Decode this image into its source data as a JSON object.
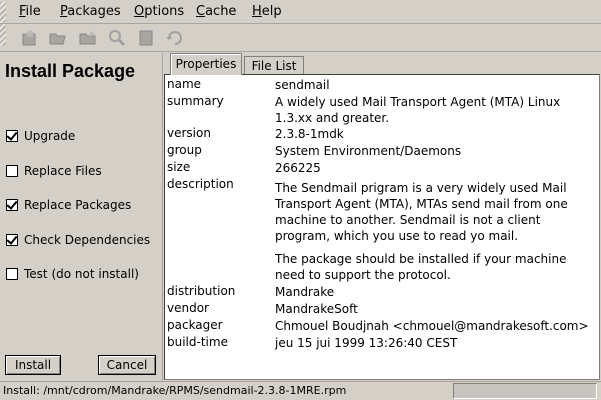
{
  "menubar": {
    "items": [
      {
        "label_mn": "F",
        "label_rest": "ile"
      },
      {
        "label_mn": "P",
        "label_rest": "ackages"
      },
      {
        "label_mn": "O",
        "label_rest": "ptions"
      },
      {
        "label_mn": "C",
        "label_rest": "ache"
      },
      {
        "label_mn": "H",
        "label_rest": "elp"
      }
    ]
  },
  "toolbar": {
    "icons": [
      "install-icon",
      "open-folder-icon",
      "folder-icon",
      "search-icon",
      "document-icon",
      "refresh-icon"
    ]
  },
  "left_panel": {
    "title": "Install Package",
    "options": [
      {
        "label": "Upgrade",
        "checked": true
      },
      {
        "label": "Replace Files",
        "checked": false
      },
      {
        "label": "Replace Packages",
        "checked": true
      },
      {
        "label": "Check Dependencies",
        "checked": true
      },
      {
        "label": "Test (do not install)",
        "checked": false
      }
    ],
    "install_label": "Install",
    "cancel_label": "Cancel"
  },
  "tabs": [
    {
      "label": "Properties",
      "active": true
    },
    {
      "label": "File List",
      "active": false
    }
  ],
  "properties": {
    "name_key": "name",
    "name_val": "sendmail",
    "summary_key": "summary",
    "summary_val": "A widely used Mail Transport Agent (MTA) Linux 1.3.xx and greater.",
    "version_key": "version",
    "version_val": "2.3.8-1mdk",
    "group_key": "group",
    "group_val": "System Environment/Daemons",
    "size_key": "size",
    "size_val": "266225",
    "description_key": "description",
    "description_val1": "The Sendmail prigram is a very widely used Mail Transport Agent (MTA), MTAs send mail from one machine to another. Sendmail is not a client program, which you use to read yo mail.",
    "description_val2": "The package should be installed if your machine need to support the protocol.",
    "distribution_key": "distribution",
    "distribution_val": "Mandrake",
    "vendor_key": "vendor",
    "vendor_val": "MandrakeSoft",
    "packager_key": "packager",
    "packager_val": "Chmouel Boudjnah <chmouel@mandrakesoft.com>",
    "buildtime_key": "build-time",
    "buildtime_val": "jeu 15 jui 1999 13:26:40 CEST"
  },
  "statusbar": {
    "text": "Install: /mnt/cdrom/Mandrake/RPMS/sendmail-2.3.8-1MRE.rpm"
  }
}
